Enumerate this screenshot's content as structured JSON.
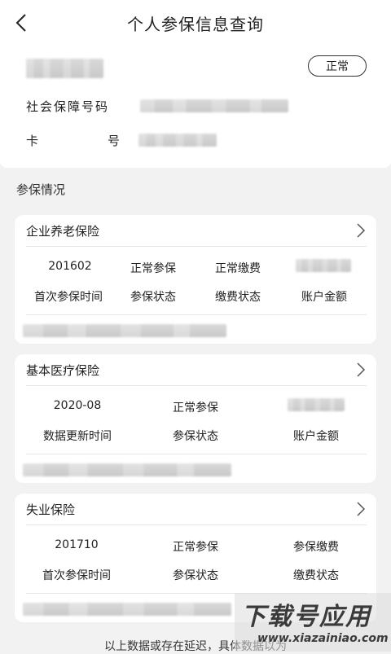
{
  "header": {
    "title": "个人参保信息查询"
  },
  "person": {
    "status": "正常",
    "ssn_label": "社会保障号码",
    "card_label_1": "卡",
    "card_label_2": "号"
  },
  "section_title": "参保情况",
  "cards": [
    {
      "title": "企业养老保险",
      "values": [
        "201602",
        "正常参保",
        "正常缴费"
      ],
      "labels": [
        "首次参保时间",
        "参保状态",
        "缴费状态",
        "账户金额"
      ]
    },
    {
      "title": "基本医疗保险",
      "values": [
        "2020-08",
        "正常参保"
      ],
      "labels": [
        "数据更新时间",
        "参保状态",
        "账户金额"
      ]
    },
    {
      "title": "失业保险",
      "values": [
        "201710",
        "正常参保",
        "参保缴费"
      ],
      "labels": [
        "首次参保时间",
        "参保状态",
        "缴费状态"
      ]
    }
  ],
  "footer": "以上数据或存在延迟，具体数据以为",
  "watermark": {
    "main": "下载号应用",
    "sub": "www.xiazainiao.com"
  }
}
